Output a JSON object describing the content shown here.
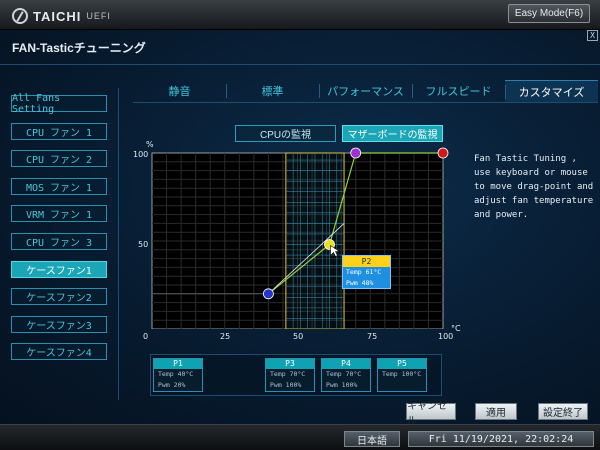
{
  "header": {
    "logo_text": "TAICHI",
    "logo_sub": "UEFI",
    "easy_mode": "Easy Mode(F6)"
  },
  "page": {
    "title": "FAN-Tasticチューニング",
    "close": "X"
  },
  "tabs": [
    {
      "label": "静音"
    },
    {
      "label": "標準"
    },
    {
      "label": "パフォーマンス"
    },
    {
      "label": "フルスピード"
    },
    {
      "label": "カスタマイズ",
      "active": true
    }
  ],
  "sidebar": {
    "items": [
      {
        "label": "All Fans Setting"
      },
      {
        "label": "CPU ファン 1"
      },
      {
        "label": "CPU ファン 2"
      },
      {
        "label": "MOS ファン 1"
      },
      {
        "label": "VRM ファン 1"
      },
      {
        "label": "CPU ファン 3"
      },
      {
        "label": "ケースファン1",
        "active": true
      },
      {
        "label": "ケースファン2"
      },
      {
        "label": "ケースファン3"
      },
      {
        "label": "ケースファン4"
      }
    ]
  },
  "monitor": {
    "cpu": "CPUの監視",
    "motherboard": "マザーボードの監視"
  },
  "chart": {
    "y_unit": "%",
    "x_unit": "°C",
    "x_ticks": [
      "0",
      "25",
      "50",
      "75",
      "100"
    ],
    "y_ticks": [
      "100",
      "50"
    ]
  },
  "chart_data": {
    "type": "line",
    "xlabel": "°C",
    "ylabel": "%",
    "xlim": [
      0,
      100
    ],
    "ylim": [
      0,
      100
    ],
    "grid": true,
    "points": [
      {
        "label": "P1",
        "temp": 40,
        "pwm": 20,
        "color": "#2236c8"
      },
      {
        "label": "P2",
        "temp": 61,
        "pwm": 48,
        "color": "#e8e020"
      },
      {
        "label": "P3",
        "temp": 70,
        "pwm": 100,
        "color": "#a030d0"
      },
      {
        "label": "P5",
        "temp": 100,
        "pwm": 100,
        "color": "#d01818"
      }
    ],
    "highlight_band": {
      "x_from": 46,
      "x_to": 66,
      "y_from": 0,
      "y_to": 100
    }
  },
  "tooltip": {
    "title": "P2",
    "temp": "Temp 61°C",
    "pwm": "Pwm  48%"
  },
  "help": "Fan Tastic Tuning , use keyboard or mouse to move drag-point and adjust fan temperature and power.",
  "cards": [
    {
      "name": "P1",
      "temp": "Temp 40°C",
      "pwm": "Pwm  20%"
    },
    {
      "name": "P3",
      "temp": "Temp 70°C",
      "pwm": "Pwm  100%"
    },
    {
      "name": "P4",
      "temp": "Temp 70°C",
      "pwm": "Pwm  100%"
    },
    {
      "name": "P5",
      "temp": "Temp 100°C",
      "pwm": ""
    }
  ],
  "actions": {
    "cancel": "キャンセル",
    "apply": "適用",
    "finish": "設定終了"
  },
  "footer": {
    "language": "日本語",
    "datetime": "Fri 11/19/2021, 22:02:24"
  },
  "colors": {
    "accent": "#1aa6b6",
    "curve": "#8fd13a",
    "band": "#e0c43a"
  }
}
